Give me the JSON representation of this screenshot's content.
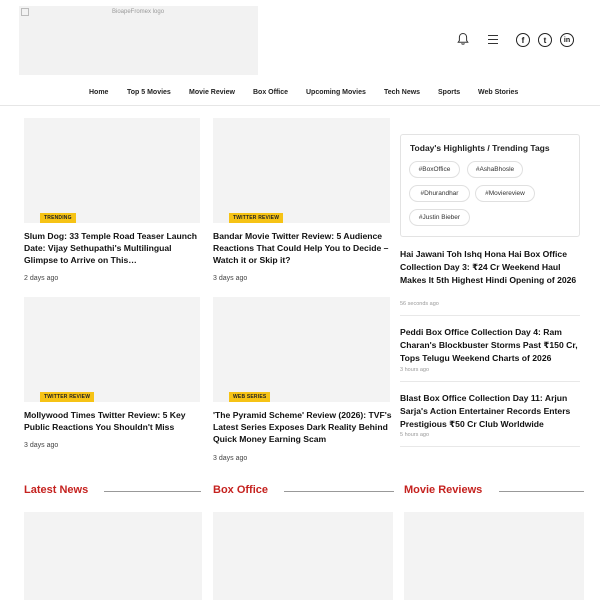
{
  "header": {
    "logo_alt": "BioapeFromex logo"
  },
  "nav": [
    {
      "label": "Home"
    },
    {
      "label": "Top 5 Movies"
    },
    {
      "label": "Movie Review"
    },
    {
      "label": "Box Office"
    },
    {
      "label": "Upcoming Movies"
    },
    {
      "label": "Tech News"
    },
    {
      "label": "Sports"
    },
    {
      "label": "Web Stories"
    }
  ],
  "social": {
    "facebook": "f",
    "twitter": "t",
    "linkedin": "in"
  },
  "cards": [
    {
      "tag": "Trending",
      "title": "Slum Dog: 33 Temple Road Teaser Launch Date: Vijay Sethupathi's Multilingual Glimpse to Arrive on This…",
      "time": "2 days ago"
    },
    {
      "tag": "Twitter Review",
      "title": "Bandar Movie Twitter Review: 5 Audience Reactions That Could Help You to Decide – Watch it or Skip it?",
      "time": "3 days ago"
    },
    {
      "tag": "Twitter Review",
      "title": "Mollywood Times Twitter Review: 5 Key Public Reactions You Shouldn't Miss",
      "time": "3 days ago"
    },
    {
      "tag": "Web Series",
      "title": "'The Pyramid Scheme' Review (2026): TVF's Latest Series Exposes Dark Reality Behind Quick Money Earning Scam",
      "time": "3 days ago"
    }
  ],
  "sidebar": {
    "heading": "Today's Highlights / Trending Tags",
    "tags": [
      "#BoxOffice",
      "#AshaBhosle",
      "#Dhurandhar",
      "#Moviereview",
      "#Justin Bieber"
    ],
    "stories": [
      {
        "title": "Hai Jawani Toh Ishq Hona Hai Box Office Collection Day 3: ₹24 Cr Weekend Haul Makes It 5th Highest Hindi Opening of 2026",
        "time": "56 seconds ago"
      },
      {
        "title": "Peddi Box Office Collection Day 4: Ram Charan's Blockbuster Storms Past ₹150 Cr, Tops Telugu Weekend Charts of 2026",
        "time": "3 hours ago"
      },
      {
        "title": "Blast Box Office Collection Day 11: Arjun Sarja's Action Entertainer Records Enters Prestigious ₹50 Cr Club Worldwide",
        "time": "5 hours ago"
      }
    ]
  },
  "sections": [
    {
      "title": "Latest News"
    },
    {
      "title": "Box Office"
    },
    {
      "title": "Movie Reviews"
    }
  ],
  "colors": {
    "accent_red": "#c5221f",
    "tag_yellow": "#f6c315"
  }
}
